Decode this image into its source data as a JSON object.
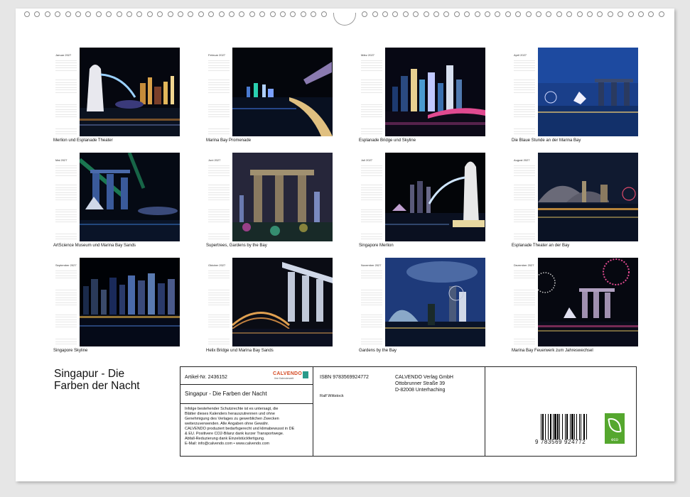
{
  "calendar": {
    "title_line1": "Singapur - Die",
    "title_line2": "Farben der Nacht",
    "months": [
      {
        "name": "Januar 2027",
        "caption": "Merlion und Esplanade Theater"
      },
      {
        "name": "Februar 2027",
        "caption": "Marina Bay Promenade"
      },
      {
        "name": "März 2027",
        "caption": "Esplanade Bridge und Skyline"
      },
      {
        "name": "April 2027",
        "caption": "Die Blaue Stunde an der Marina Bay"
      },
      {
        "name": "Mai 2027",
        "caption": "ArtScience Museum und Marina Bay Sands"
      },
      {
        "name": "Juni 2027",
        "caption": "Supertrees, Gardens by the Bay"
      },
      {
        "name": "Juli 2027",
        "caption": "Singapore Merlion"
      },
      {
        "name": "August 2027",
        "caption": "Esplanade Theater an der Bay"
      },
      {
        "name": "September 2027",
        "caption": "Singapore Skyline"
      },
      {
        "name": "Oktober 2027",
        "caption": "Helix Bridge und Marina Bay Sands"
      },
      {
        "name": "November 2027",
        "caption": "Gardens by the Bay"
      },
      {
        "name": "Dezember 2027",
        "caption": "Marina Bay Feuerwerk zum Jahreswechsel"
      }
    ]
  },
  "info": {
    "article": "Artikel-Nr. 2436152",
    "calvendo_logo": "CALVENDO",
    "calvendo_sub": "Ihre Kalenderwelt",
    "product_title": "Singapur - Die Farben der Nacht",
    "legal_lines": [
      "Infolge bestehender Schutzrechte ist es untersagt, die",
      "Blätter dieses Kalenders herauszutrennen und ohne",
      "Genehmigung des Verlages zu gewerblichen Zwecken",
      "weiterzuverwenden. Alle Angaben ohne Gewähr.",
      "CALVENDO produziert bedarfsgerecht und klimabewusst in DE",
      "& EU. Positivere CO2-Bilanz dank kurzer Transportwege.",
      "Abfall-Reduzierung dank Einzelstückfertigung.",
      "E-Mail: info@calvendo.com • www.calvendo.com"
    ],
    "isbn": "ISBN 9783569924772",
    "author": "Ralf Wittstock",
    "publisher_lines": [
      "CALVENDO Verlag GmbH",
      "Ottobrunner Straße 39",
      "D-82008 Unterhaching"
    ],
    "ean_text": "9 783569 924772",
    "eco_label": "eco"
  },
  "colors": {
    "eco_green": "#55a72e",
    "calvendo_orange": "#d44a22",
    "calvendo_teal": "#2a9a8a"
  }
}
